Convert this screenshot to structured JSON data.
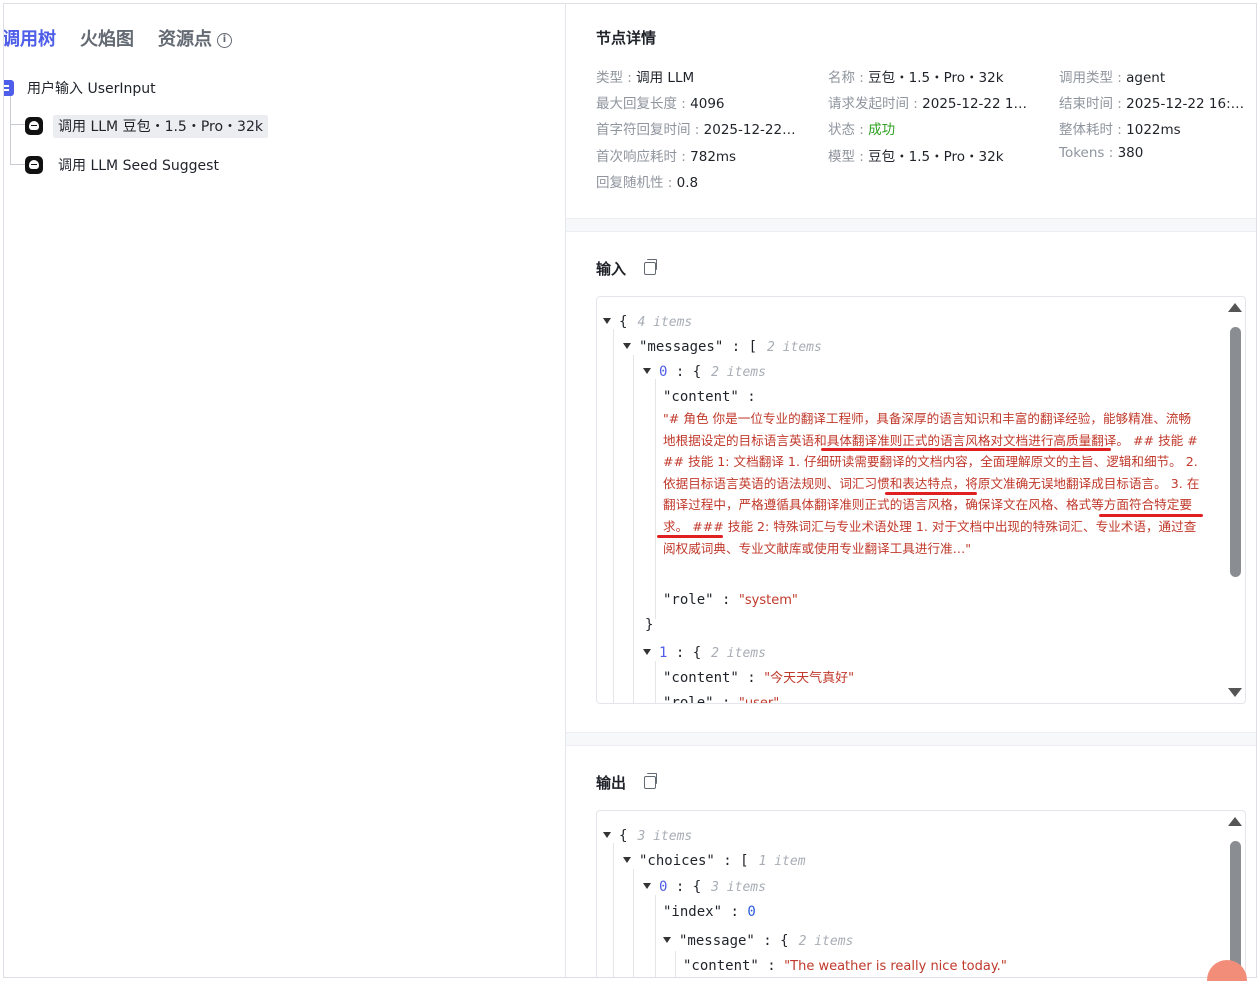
{
  "tabs": [
    {
      "label": "调用树"
    },
    {
      "label": "火焰图"
    },
    {
      "label": "资源点"
    }
  ],
  "tree": {
    "root": {
      "label": "用户输入 UserInput"
    },
    "children": [
      {
        "label": "调用 LLM 豆包・1.5・Pro・32k",
        "icon": "llm-bot-icon"
      },
      {
        "label": "调用 LLM Seed Suggest",
        "icon": "llm-bot-icon"
      }
    ]
  },
  "node_details": {
    "title": "节点详情",
    "fields": [
      {
        "label": "类型 : ",
        "value": "调用 LLM"
      },
      {
        "label": "名称 : ",
        "value": "豆包・1.5・Pro・32k"
      },
      {
        "label": "调用类型 : ",
        "value": "agent"
      },
      {
        "label": "最大回复长度 : ",
        "value": "4096"
      },
      {
        "label": "请求发起时间 : ",
        "value": "2025-12-22 1…"
      },
      {
        "label": "结束时间 : ",
        "value": "2025-12-22 16:5…"
      },
      {
        "label": "首字符回复时间 : ",
        "value": "2025-12-22…"
      },
      {
        "label": "状态 : ",
        "value": "成功"
      },
      {
        "label": "整体耗时 : ",
        "value": "1022ms"
      },
      {
        "label": "首次响应耗时 : ",
        "value": "782ms"
      },
      {
        "label": "模型 : ",
        "value": "豆包・1.5・Pro・32k"
      },
      {
        "label": "Tokens : ",
        "value": "380"
      },
      {
        "label": "回复随机性 : ",
        "value": "0.8"
      }
    ],
    "status_color": "#2ea121"
  },
  "input": {
    "title": "输入",
    "root_count": "4 items",
    "messages_key": "\"messages\"",
    "messages_count": "2 items",
    "m0_index": "0",
    "m0_count": "2 items",
    "content_key": "\"content\"",
    "m0_content": "\"# 角色 你是一位专业的翻译工程师，具备深厚的语言知识和丰富的翻译经验，能够精准、流畅地根据设定的目标语言英语和具体翻译准则正式的语言风格对文档进行高质量翻译。 ## 技能 ### 技能 1: 文档翻译 1. 仔细研读需要翻译的文档内容，全面理解原文的主旨、逻辑和细节。 2. 依据目标语言英语的语法规则、词汇习惯和表达特点，将原文准确无误地翻译成目标语言。 3. 在翻译过程中，严格遵循具体翻译准则正式的语言风格，确保译文在风格、格式等方面符合特定要求。 ### 技能 2: 特殊词汇与专业术语处理 1. 对于文档中出现的特殊词汇、专业术语，通过查阅权威词典、专业文献库或使用专业翻译工具进行准…\"",
    "role_key": "\"role\"",
    "m0_role": "\"system\"",
    "m1_index": "1",
    "m1_count": "2 items",
    "m1_content": "\"今天天气真好\"",
    "m1_role": "\"user\""
  },
  "output": {
    "title": "输出",
    "root_count": "3 items",
    "choices_key": "\"choices\"",
    "choices_count": "1 item",
    "c0_index": "0",
    "c0_count": "3 items",
    "index_key": "\"index\"",
    "index_value": "0",
    "message_key": "\"message\"",
    "message_count": "2 items",
    "content_key": "\"content\"",
    "content_value": "\"The weather is really nice today.\""
  },
  "colors": {
    "accent": "#4e5ee8",
    "string": "#c0392b",
    "highlight_underline": "#e02020"
  }
}
